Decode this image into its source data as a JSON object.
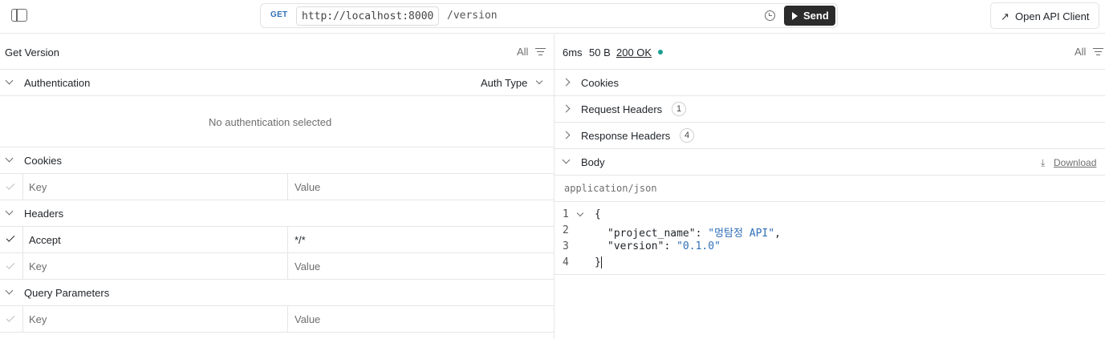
{
  "topbar": {
    "method": "GET",
    "base_url": "http://localhost:8000",
    "path": "/version",
    "send_label": "Send",
    "open_api_label": "Open API Client"
  },
  "request": {
    "title": "Get Version",
    "filter_label": "All",
    "auth": {
      "section_label": "Authentication",
      "type_label": "Auth Type",
      "empty_text": "No authentication selected"
    },
    "cookies": {
      "section_label": "Cookies",
      "key_placeholder": "Key",
      "value_placeholder": "Value"
    },
    "headers": {
      "section_label": "Headers",
      "rows": [
        {
          "key": "Accept",
          "value": "*/*",
          "enabled": true
        }
      ],
      "key_placeholder": "Key",
      "value_placeholder": "Value"
    },
    "query": {
      "section_label": "Query Parameters",
      "key_placeholder": "Key",
      "value_placeholder": "Value"
    }
  },
  "response": {
    "time": "6ms",
    "size": "50 B",
    "status": "200 OK",
    "status_color": "#1a9e8f",
    "filter_label": "All",
    "sections": {
      "cookies": "Cookies",
      "request_headers": "Request Headers",
      "request_headers_count": "1",
      "response_headers": "Response Headers",
      "response_headers_count": "4",
      "body": "Body",
      "download": "Download"
    },
    "content_type": "application/json",
    "body_lines": {
      "l1_num": "1",
      "l1": "{",
      "l2_num": "2",
      "l2_key": "\"project_name\"",
      "l2_sep": ": ",
      "l2_val": "\"멍탐정 API\"",
      "l2_end": ",",
      "l3_num": "3",
      "l3_key": "\"version\"",
      "l3_sep": ": ",
      "l3_val": "\"0.1.0\"",
      "l4_num": "4",
      "l4": "}"
    }
  }
}
